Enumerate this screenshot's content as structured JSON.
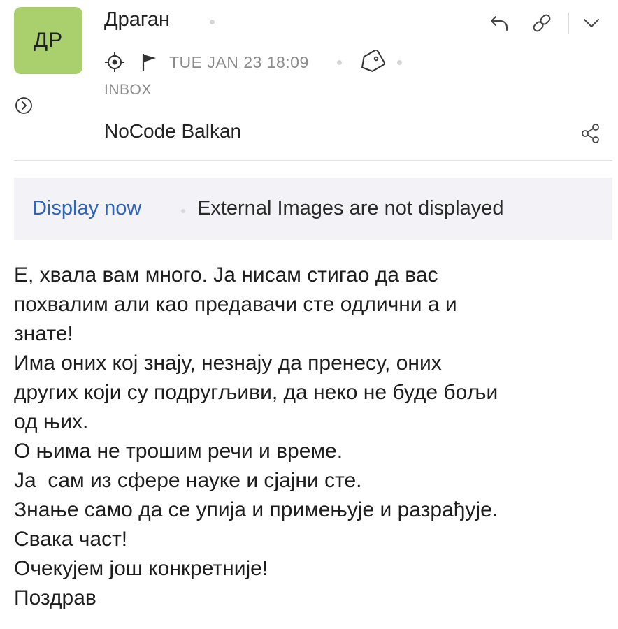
{
  "sender": {
    "initials": "ДР",
    "avatar_color": "#a9d06d",
    "name": "Драган"
  },
  "meta": {
    "date": "TUE JAN 23 18:09",
    "folder": "INBOX"
  },
  "subject": "NoCode Balkan",
  "external_images": {
    "action_label": "Display now",
    "message": "External Images are not displayed",
    "link_color": "#2e65b8"
  },
  "body_lines": [
    "Е, хвала вам много. Ја нисам стигао да вас",
    "похвалим али као предавачи сте одлични а и",
    "знате!",
    "Има оних кој знају, незнају да пренесу, оних",
    "других који су подругљиви, да неко не буде бољи",
    "од њих.",
    "О њима не трошим речи и време.",
    "Ја  сам из сфере науке и сјајни сте.",
    "Знање само да се упија и примењује и разрађује.",
    "Свака част!",
    "Очекујем још конкретније!",
    "Поздрав"
  ],
  "icons": {
    "expand": "chevron-right-circle-icon",
    "locate": "target-icon",
    "flag": "flag-icon",
    "tag": "tag-icon",
    "reply": "reply-icon",
    "link": "link-icon",
    "more": "chevron-down-icon",
    "share": "share-icon"
  }
}
